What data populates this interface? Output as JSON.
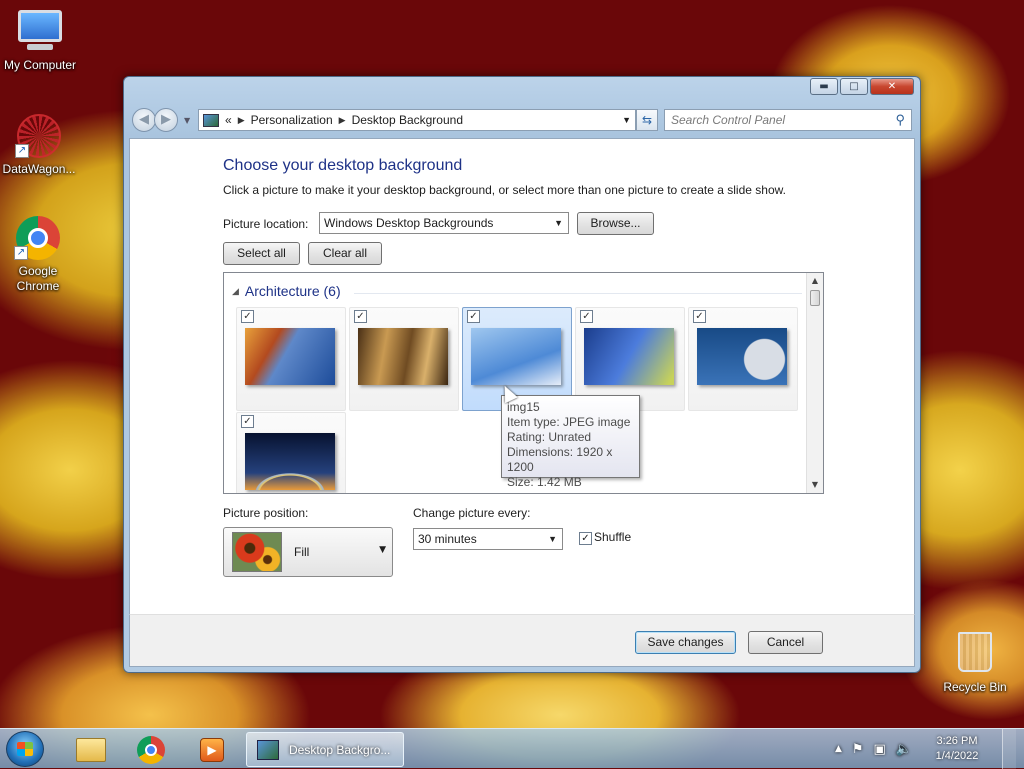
{
  "desktop": {
    "icons": [
      {
        "label": "My Computer"
      },
      {
        "label": "DataWagon..."
      },
      {
        "label": "Google\nChrome"
      },
      {
        "label": "Recycle Bin"
      }
    ]
  },
  "window": {
    "controls": {
      "minimize": "▬",
      "maximize": "□",
      "close": "✕"
    },
    "address": {
      "prefix": "«",
      "crumbs": [
        "Personalization",
        "Desktop Background"
      ]
    },
    "search_placeholder": "Search Control Panel",
    "title": "Choose your desktop background",
    "subtitle": "Click a picture to make it your desktop background, or select more than one picture to create a slide show.",
    "picture_location_label": "Picture location:",
    "picture_location_value": "Windows Desktop Backgrounds",
    "browse_label": "Browse...",
    "select_all_label": "Select all",
    "clear_all_label": "Clear all",
    "group_title": "Architecture (6)",
    "tooltip": {
      "name": "img15",
      "type": "Item type: JPEG image",
      "rating": "Rating: Unrated",
      "dimensions": "Dimensions: 1920 x 1200",
      "size": "Size: 1.42 MB"
    },
    "picture_position_label": "Picture position:",
    "picture_position_value": "Fill",
    "change_every_label": "Change picture every:",
    "change_every_value": "30 minutes",
    "shuffle_label": "Shuffle",
    "shuffle_checked": true,
    "save_label": "Save changes",
    "cancel_label": "Cancel"
  },
  "taskbar": {
    "active_task": "Desktop Backgro...",
    "time": "3:26 PM",
    "date": "1/4/2022"
  }
}
